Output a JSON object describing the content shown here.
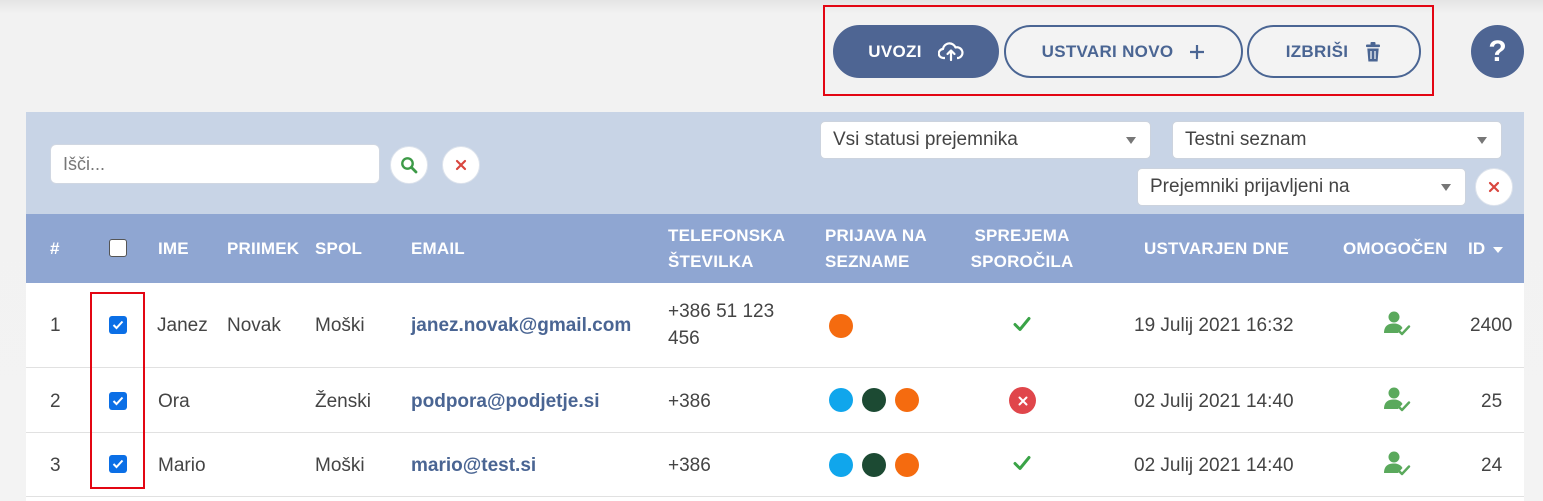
{
  "toolbar": {
    "import_label": "UVOZI",
    "create_label": "USTVARI NOVO",
    "delete_label": "IZBRIŠI",
    "help_label": "?"
  },
  "filters": {
    "search_placeholder": "Išči...",
    "status_select": "Vsi statusi prejemnika",
    "list_select": "Testni seznam",
    "subscribed_select": "Prejemniki prijavljeni na"
  },
  "table": {
    "headers": {
      "num": "#",
      "first_name": "IME",
      "last_name": "PRIIMEK",
      "gender": "SPOL",
      "email": "EMAIL",
      "phone_1": "TELEFONSKA",
      "phone_2": "ŠTEVILKA",
      "lists_1": "PRIJAVA NA",
      "lists_2": "SEZNAME",
      "accepts_1": "SPREJEMA",
      "accepts_2": "SPOROČILA",
      "created": "USTVARJEN DNE",
      "enabled": "OMOGOČEN",
      "id": "ID"
    },
    "rows": [
      {
        "num": "1",
        "checked": true,
        "first_name": "Janez",
        "last_name": "Novak",
        "gender": "Moški",
        "email": "janez.novak@gmail.com",
        "phone_1": "+386 51 123",
        "phone_2": "456",
        "list_dots": [
          "#f56b0f"
        ],
        "accepts": true,
        "created": "19 Julij 2021 16:32",
        "enabled_icon": "user-check-icon",
        "id": "2400"
      },
      {
        "num": "2",
        "checked": true,
        "first_name": "Ora",
        "last_name": "",
        "gender": "Ženski",
        "email": "podpora@podjetje.si",
        "phone_1": "+386",
        "phone_2": "",
        "list_dots": [
          "#10a6ec",
          "#1c4a33",
          "#f56b0f"
        ],
        "accepts": false,
        "created": "02 Julij 2021 14:40",
        "enabled_icon": "user-check-icon",
        "id": "25"
      },
      {
        "num": "3",
        "checked": true,
        "first_name": "Mario",
        "last_name": "",
        "gender": "Moški",
        "email": "mario@test.si",
        "phone_1": "+386",
        "phone_2": "",
        "list_dots": [
          "#10a6ec",
          "#1c4a33",
          "#f56b0f"
        ],
        "accepts": true,
        "created": "02 Julij 2021 14:40",
        "enabled_icon": "user-check-icon",
        "id": "24"
      }
    ]
  },
  "colors": {
    "brand": "#4e6593",
    "header_bg": "#8fa6d2",
    "filter_bg": "#c8d4e6",
    "highlight": "#e30613",
    "check_green": "#3aa347",
    "cancel_red": "#e0464b"
  }
}
